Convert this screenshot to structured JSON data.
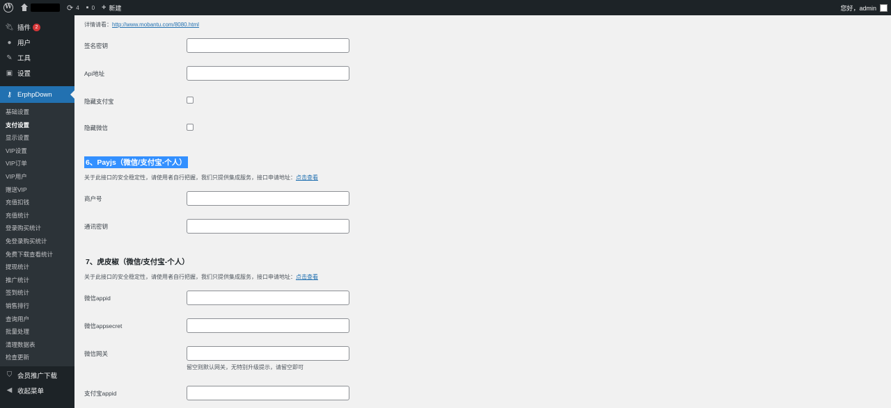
{
  "adminbar": {
    "updates_count": "4",
    "comments_count": "0",
    "new_label": "新建",
    "greeting": "您好，admin"
  },
  "sidebar": {
    "top_items": [
      {
        "label": "插件",
        "icon": "plugin-icon",
        "badge": "2"
      },
      {
        "label": "用户",
        "icon": "users-icon"
      },
      {
        "label": "工具",
        "icon": "tools-icon"
      },
      {
        "label": "设置",
        "icon": "settings-icon"
      }
    ],
    "current": {
      "label": "ErphpDown",
      "icon": "key-icon"
    },
    "submenu": [
      "基础设置",
      "支付设置",
      "显示设置",
      "VIP设置",
      "VIP订单",
      "VIP用户",
      "赠送VIP",
      "充值扣钱",
      "充值统计",
      "登录购买统计",
      "免登录购买统计",
      "免费下载查看统计",
      "提现统计",
      "推广统计",
      "签到统计",
      "销售排行",
      "查询用户",
      "批量处理",
      "清理数据表",
      "检查更新"
    ],
    "active_submenu": "支付设置",
    "bottom_items": [
      {
        "label": "会员推广下载",
        "icon": "shield-icon"
      },
      {
        "label": "收起菜单",
        "icon": "collapse-icon"
      }
    ]
  },
  "content": {
    "top_note": {
      "prefix": "详情请看：",
      "link": "http://www.mobantu.com/8080.html"
    },
    "fields_a": [
      {
        "label": "签名密钥"
      },
      {
        "label": "Api地址"
      }
    ],
    "checkboxes": [
      {
        "label": "隐藏支付宝"
      },
      {
        "label": "隐藏微信"
      }
    ],
    "section6": {
      "title": "6、Payjs（微信/支付宝-个人）",
      "desc": "关于此接口的安全稳定性，请使用者自行把握，我们只提供集成服务，接口申请地址：",
      "link": "点击查看",
      "fields": [
        {
          "label": "商户号"
        },
        {
          "label": "通讯密钥"
        }
      ]
    },
    "section7": {
      "title": "7、虎皮椒（微信/支付宝-个人）",
      "desc": "关于此接口的安全稳定性，请使用者自行把握，我们只提供集成服务，接口申请地址：",
      "link": "点击查看",
      "fields": [
        {
          "label": "微信appid"
        },
        {
          "label": "微信appsecret"
        },
        {
          "label": "微信网关"
        },
        {
          "label": "支付宝appid"
        }
      ],
      "gateway_help": "留空则默认网关，无特别升级提示，请留空即可"
    }
  }
}
